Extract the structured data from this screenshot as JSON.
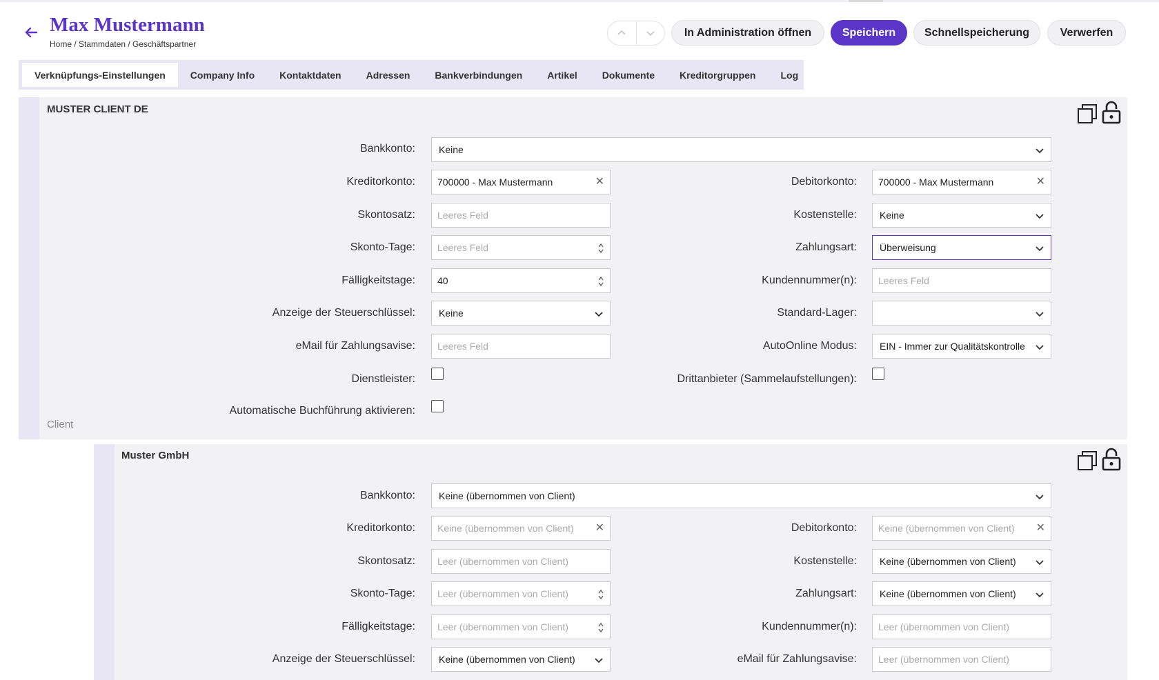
{
  "header": {
    "title": "Max Mustermann",
    "breadcrumb": "Home / Stammdaten / Geschäftspartner"
  },
  "actions": {
    "open_admin": "In Administration öffnen",
    "save": "Speichern",
    "quick_save": "Schnellspeicherung",
    "discard": "Verwerfen"
  },
  "tabs": [
    {
      "label": "Verknüpfungs-Einstellungen"
    },
    {
      "label": "Company Info"
    },
    {
      "label": "Kontaktdaten"
    },
    {
      "label": "Adressen"
    },
    {
      "label": "Bankverbindungen"
    },
    {
      "label": "Artikel"
    },
    {
      "label": "Dokumente"
    },
    {
      "label": "Kreditorgruppen"
    },
    {
      "label": "Log"
    }
  ],
  "client": {
    "title": "MUSTER CLIENT DE",
    "footer": "Client",
    "bankkonto": {
      "label": "Bankkonto:",
      "value": "Keine"
    },
    "kreditorkonto": {
      "label": "Kreditorkonto:",
      "value": "700000 - Max Mustermann"
    },
    "debitorkonto": {
      "label": "Debitorkonto:",
      "value": "700000 - Max Mustermann"
    },
    "skontosatz": {
      "label": "Skontosatz:",
      "placeholder": "Leeres Feld"
    },
    "kostenstelle": {
      "label": "Kostenstelle:",
      "value": "Keine"
    },
    "skonto_tage": {
      "label": "Skonto-Tage:",
      "placeholder": "Leeres Feld"
    },
    "zahlungsart": {
      "label": "Zahlungsart:",
      "value": "Überweisung"
    },
    "faelligkeitstage": {
      "label": "Fälligkeitstage:",
      "value": "40"
    },
    "kundennummer": {
      "label": "Kundennummer(n):",
      "placeholder": "Leeres Feld"
    },
    "steuerschluessel": {
      "label": "Anzeige der Steuerschlüssel:",
      "value": "Keine"
    },
    "standard_lager": {
      "label": "Standard-Lager:",
      "value": ""
    },
    "email_zahlungsavise": {
      "label": "eMail für Zahlungsavise:",
      "placeholder": "Leeres Feld"
    },
    "autoonline": {
      "label": "AutoOnline Modus:",
      "value": "EIN - Immer zur Qualitätskontrolle"
    },
    "dienstleister": {
      "label": "Dienstleister:",
      "checked": false
    },
    "drittanbieter": {
      "label": "Drittanbieter (Sammelaufstellungen):",
      "checked": false
    },
    "auto_buchfuehrung": {
      "label": "Automatische Buchführung aktivieren:",
      "checked": false
    }
  },
  "company": {
    "title": "Muster GmbH",
    "bankkonto": {
      "label": "Bankkonto:",
      "value": "Keine (übernommen von Client)"
    },
    "kreditorkonto": {
      "label": "Kreditorkonto:",
      "placeholder": "Keine (übernommen von Client)"
    },
    "debitorkonto": {
      "label": "Debitorkonto:",
      "placeholder": "Keine (übernommen von Client)"
    },
    "skontosatz": {
      "label": "Skontosatz:",
      "placeholder": "Leer (übernommen von Client)"
    },
    "kostenstelle": {
      "label": "Kostenstelle:",
      "value": "Keine (übernommen von Client)"
    },
    "skonto_tage": {
      "label": "Skonto-Tage:",
      "placeholder": "Leer (übernommen von Client)"
    },
    "zahlungsart": {
      "label": "Zahlungsart:",
      "value": "Keine (übernommen von Client)"
    },
    "faelligkeitstage": {
      "label": "Fälligkeitstage:",
      "placeholder": "Leer (übernommen von Client)"
    },
    "kundennummer": {
      "label": "Kundennummer(n):",
      "placeholder": "Leer (übernommen von Client)"
    },
    "steuerschluessel": {
      "label": "Anzeige der Steuerschlüssel:",
      "value": "Keine (übernommen von Client)"
    },
    "email_zahlungsavise": {
      "label": "eMail für Zahlungsavise:",
      "placeholder": "Leer (übernommen von Client)"
    }
  },
  "colors": {
    "accent": "#5b35c8",
    "tab_bar": "#e8e5f5",
    "section_bg": "#f2f2f4"
  }
}
